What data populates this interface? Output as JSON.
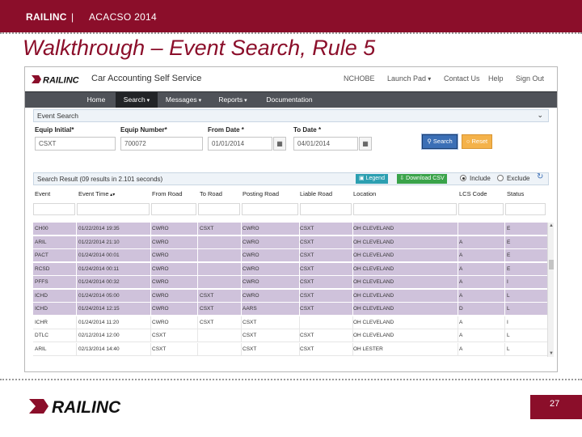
{
  "slide": {
    "brand": "RAILINC",
    "separator": "|",
    "conference": "ACACSO 2014",
    "title": "Walkthrough – Event Search, Rule 5",
    "page_number": "27",
    "logo_text": "RAILINC",
    "brand_color": "#8b0e2a"
  },
  "app": {
    "logo_text": "RAILINC",
    "title": "Car Accounting Self Service",
    "top_links": [
      "NCHOBE",
      "Launch Pad",
      "Contact Us",
      "Help",
      "Sign Out"
    ],
    "nav": [
      "Home",
      "Search",
      "Messages",
      "Reports",
      "Documentation"
    ],
    "active_nav": "Search",
    "panel_title": "Event Search",
    "fields": {
      "equip_initial": {
        "label": "Equip Initial*",
        "value": "CSXT"
      },
      "equip_number": {
        "label": "Equip Number*",
        "value": "700072"
      },
      "from_date": {
        "label": "From Date *",
        "value": "01/01/2014"
      },
      "to_date": {
        "label": "To Date *",
        "value": "04/01/2014"
      }
    },
    "search_button": "Search",
    "reset_button": "Reset",
    "results_text": "Search Result (09 results in 2.101 seconds)",
    "legend_button": "Legend",
    "csv_button": "Download CSV",
    "include_label": "Include",
    "exclude_label": "Exclude",
    "columns": [
      "Event",
      "Event Time",
      "From Road",
      "To Road",
      "Posting Road",
      "Liable Road",
      "Location",
      "LCS Code",
      "Status"
    ],
    "rows": [
      {
        "cells": [
          "CH00",
          "01/22/2014 19:35",
          "CWRO",
          "CSXT",
          "CWRO",
          "CSXT",
          "OH CLEVELAND",
          "",
          "E"
        ],
        "highlight": true
      },
      {
        "cells": [
          "ARIL",
          "01/22/2014 21:10",
          "CWRO",
          "",
          "CWRO",
          "CSXT",
          "OH CLEVELAND",
          "A",
          "E"
        ],
        "highlight": true
      },
      {
        "cells": [
          "PACT",
          "01/24/2014 00:01",
          "CWRO",
          "",
          "CWRO",
          "CSXT",
          "OH CLEVELAND",
          "A",
          "E"
        ],
        "highlight": true
      },
      {
        "cells": [
          "RCSD",
          "01/24/2014 00:11",
          "CWRO",
          "",
          "CWRO",
          "CSXT",
          "OH CLEVELAND",
          "A",
          "E"
        ],
        "highlight": true
      },
      {
        "cells": [
          "PFFS",
          "01/24/2014 00:32",
          "CWRO",
          "",
          "CWRO",
          "CSXT",
          "OH CLEVELAND",
          "A",
          "I"
        ],
        "highlight": true
      },
      {
        "cells": [
          "ICHD",
          "01/24/2014 05:00",
          "CWRO",
          "CSXT",
          "CWRO",
          "CSXT",
          "OH CLEVELAND",
          "A",
          "L"
        ],
        "highlight": true
      },
      {
        "cells": [
          "ICHD",
          "01/24/2014 12:15",
          "CWRO",
          "CSXT",
          "AARS",
          "CSXT",
          "OH CLEVELAND",
          "D",
          "L"
        ],
        "highlight": true
      },
      {
        "cells": [
          "ICHR",
          "01/24/2014 11:20",
          "CWRO",
          "CSXT",
          "CSXT",
          "",
          "OH CLEVELAND",
          "A",
          "I"
        ],
        "highlight": false
      },
      {
        "cells": [
          "DTLC",
          "02/12/2014 12:00",
          "CSXT",
          "",
          "CSXT",
          "CSXT",
          "OH CLEVELAND",
          "A",
          "L"
        ],
        "highlight": false
      },
      {
        "cells": [
          "ARIL",
          "02/13/2014 14:40",
          "CSXT",
          "",
          "CSXT",
          "CSXT",
          "OH LESTER",
          "A",
          "L"
        ],
        "highlight": false
      }
    ],
    "colors": {
      "row_highlight": "#cfc2db",
      "nav_bg": "#4f5258",
      "search_btn": "#3b6fb6",
      "reset_btn": "#f4b24a",
      "legend_btn": "#2c9fb1",
      "csv_btn": "#3aa34a"
    }
  }
}
